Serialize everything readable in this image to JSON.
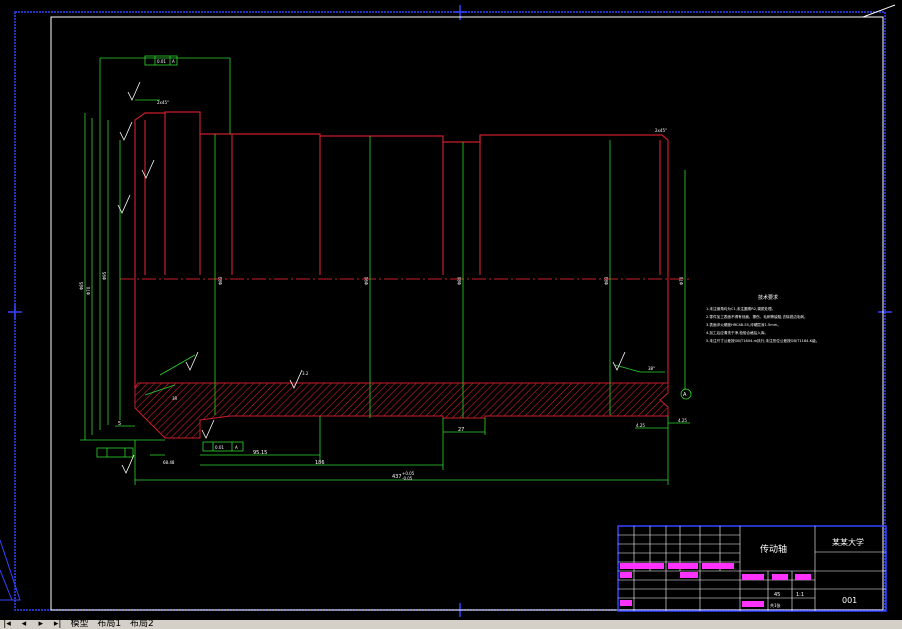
{
  "drawing": {
    "notes_title": "技术要求",
    "notes": [
      "1.未注倒角均为C1,未注圆角R2,调质处理。",
      "2.零件加工表面不得有划痕、擦伤、毛刺等缺陷,去除锐边毛刺。",
      "3.表面淬火硬度HRC48-55,淬硬层深1.5mm。",
      "4.加工后应清洗干净,检验合格后入库。",
      "5.未注尺寸公差按GB/T1804-m执行,未注形位公差按GB/T1184-K级。"
    ],
    "dims": {
      "d_total": "437",
      "d_total_tol": "+0.05",
      "d_total_tol2": "-0.05",
      "d_186": "186",
      "d_9515": "95.15",
      "d_27": "27",
      "d_5": "5",
      "d_68": "68.48",
      "d_4": "4.25",
      "d_chamfer1": "2x45°",
      "d_chamfer2": "2x45°",
      "d_radius": "3R",
      "d_a38": "38°",
      "dia_a": "Φ85",
      "dia_b": "Φ70",
      "dia_c": "Φ95",
      "dia_d": "Φ83",
      "dia_e": "Φ90",
      "dia_f": "Φ80",
      "rough": "3.2",
      "tol_frame_a": "0.01",
      "datum_a": "A",
      "datum_b": "A"
    },
    "title_block": {
      "part_name": "传动轴",
      "company": "某某大学",
      "drawing_no": "001",
      "material": "45",
      "scale": "1:1",
      "sheet": "共1张"
    }
  },
  "tabs": [
    {
      "label": "模型"
    },
    {
      "label": "布局1"
    },
    {
      "label": "布局2"
    }
  ],
  "colors": {
    "border": "#3344ff",
    "inner_border": "#ffffff",
    "outline": "#c81e2b",
    "dim": "#2fd62f",
    "text": "#ffffff",
    "hatch": "#c81e2b",
    "title_accent": "#ff33ff"
  }
}
